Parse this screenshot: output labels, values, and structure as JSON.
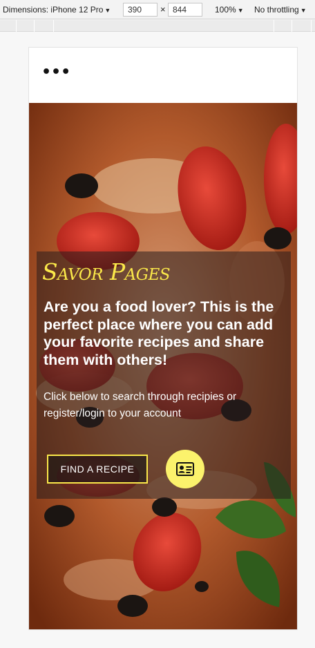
{
  "devtools": {
    "dimensions_label": "Dimensions: iPhone 12 Pro",
    "width_value": "390",
    "times_sign": "×",
    "height_value": "844",
    "zoom_label": "100%",
    "throttle_label": "No throttling",
    "caret": "▼"
  },
  "nav": {
    "menu_glyph": "•••",
    "menu_icon": "ellipsis-icon"
  },
  "hero": {
    "brand": "Savor Pages",
    "lead": "Are you a food lover? This is the perfect place where you can add your favorite recipes and share them with others!",
    "sub": "Click below to search through recipies or register/login to your account",
    "find_button": "FIND A RECIPE",
    "account_icon": "id-card-icon"
  },
  "colors": {
    "accent": "#fbe94a",
    "account_button": "#fbf26c",
    "overlay": "#281e1e"
  }
}
